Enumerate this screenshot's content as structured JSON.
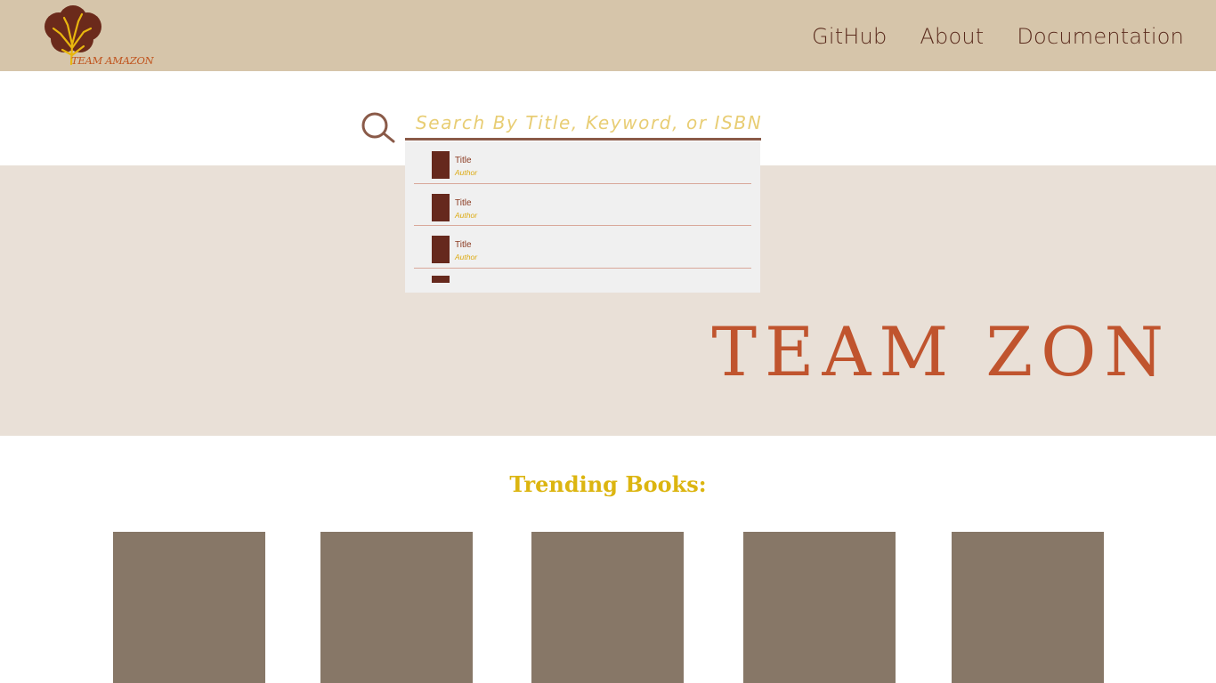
{
  "header": {
    "logo_text": "TEAM AMAZON",
    "nav": [
      {
        "label": "GitHub"
      },
      {
        "label": "About"
      },
      {
        "label": "Documentation"
      }
    ]
  },
  "search": {
    "placeholder": "Search By Title, Keyword, or ISBN",
    "value": "",
    "icon": "search-icon",
    "results": [
      {
        "title": "Title",
        "author": "Author"
      },
      {
        "title": "Title",
        "author": "Author"
      },
      {
        "title": "Title",
        "author": "Author"
      }
    ]
  },
  "hero": {
    "title": "TEAM ZON"
  },
  "trending": {
    "heading": "Trending Books:",
    "books_count_visible": 5
  },
  "colors": {
    "header_bg": "#d6c5aa",
    "hero_bg": "#e9e0d7",
    "brand_brown": "#5a2b1d",
    "accent_orange": "#c0542e",
    "accent_gold": "#dcb510",
    "book_placeholder": "#877767",
    "dropdown_bg": "#f0f0f0"
  }
}
